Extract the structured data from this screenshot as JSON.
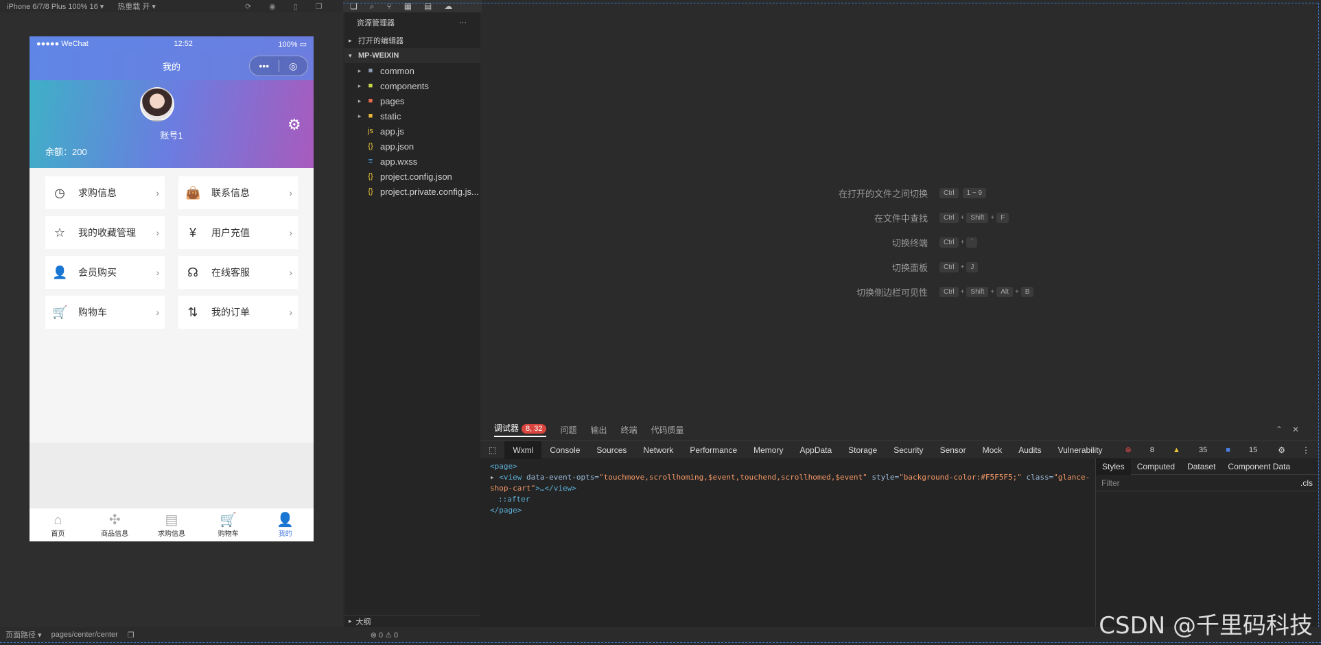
{
  "toolbar": {
    "device": "iPhone 6/7/8 Plus 100% 16 ▾",
    "hot_reload": "热重载 开 ▾"
  },
  "phone": {
    "carrier": "●●●●● WeChat",
    "time": "12:52",
    "battery": "100%",
    "nav_title": "我的",
    "capsule_more": "•••",
    "capsule_close": "◎",
    "account": "账号1",
    "balance": "余额：200",
    "grid": [
      {
        "label": "求购信息",
        "icon": "clock-icon"
      },
      {
        "label": "联系信息",
        "icon": "bag-icon"
      },
      {
        "label": "我的收藏管理",
        "icon": "star-icon"
      },
      {
        "label": "用户充值",
        "icon": "money-bag-icon"
      },
      {
        "label": "会员购买",
        "icon": "user-icon"
      },
      {
        "label": "在线客服",
        "icon": "headset-icon"
      },
      {
        "label": "购物车",
        "icon": "cart-icon"
      },
      {
        "label": "我的订单",
        "icon": "sort-icon"
      }
    ],
    "tabs": [
      "首页",
      "商品信息",
      "求购信息",
      "购物车",
      "我的"
    ]
  },
  "explorer": {
    "title": "资源管理器",
    "open_editors": "打开的编辑器",
    "project": "MP-WEIXIN",
    "items": [
      "common",
      "components",
      "pages",
      "static",
      "app.js",
      "app.json",
      "app.wxss",
      "project.config.json",
      "project.private.config.js..."
    ],
    "outline": "大纲"
  },
  "shortcuts": [
    {
      "label": "在打开的文件之间切换",
      "keys": [
        "Ctrl",
        "1 ~ 9"
      ]
    },
    {
      "label": "在文件中查找",
      "keys": [
        "Ctrl",
        "Shift",
        "F"
      ]
    },
    {
      "label": "切换终端",
      "keys": [
        "Ctrl",
        "`"
      ]
    },
    {
      "label": "切换面板",
      "keys": [
        "Ctrl",
        "J"
      ]
    },
    {
      "label": "切换侧边栏可见性",
      "keys": [
        "Ctrl",
        "Shift",
        "Alt",
        "B"
      ]
    }
  ],
  "debugger": {
    "tabs": [
      "调试器",
      "问题",
      "输出",
      "终端",
      "代码质量"
    ],
    "badge": "8, 32",
    "devtabs": [
      "Wxml",
      "Console",
      "Sources",
      "Network",
      "Performance",
      "Memory",
      "AppData",
      "Storage",
      "Security",
      "Sensor",
      "Mock",
      "Audits",
      "Vulnerability"
    ],
    "errors": "8",
    "warnings": "35",
    "info": "15",
    "code": {
      "line1": "<page>",
      "view_open": "<view",
      "attr1": "data-event-opts=",
      "val1": "\"touchmove,scrollhoming,$event,touchend,scrollhomed,$event\"",
      "attr2": "style=",
      "val2": "\"background-color:#F5F5F5;\"",
      "attr3": "class=",
      "val3": "\"glance-shop-cart\"",
      "view_close": ">…</view>",
      "after": "::after",
      "line_end": "</page>"
    },
    "style_tabs": [
      "Styles",
      "Computed",
      "Dataset",
      "Component Data"
    ],
    "filter": "Filter",
    "cls": ".cls"
  },
  "status": {
    "path_label": "页面路径 ▾",
    "path": "pages/center/center",
    "errors": "⊗ 0 ⚠ 0"
  },
  "watermark": "CSDN @千里码科技"
}
